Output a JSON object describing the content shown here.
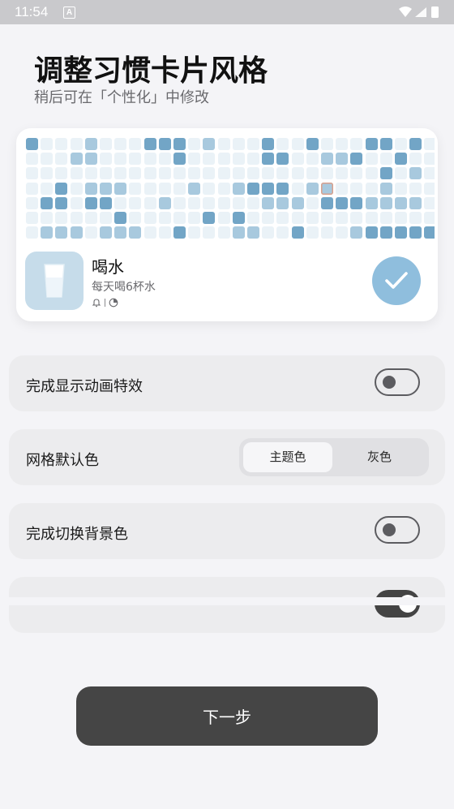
{
  "status_bar": {
    "time": "11:54",
    "notification_icon": "a-icon",
    "icons": [
      "wifi-icon",
      "signal-icon",
      "battery-icon"
    ]
  },
  "header": {
    "title": "调整习惯卡片风格",
    "subtitle": "稍后可在「个性化」中修改"
  },
  "preview": {
    "habit_name": "喝水",
    "habit_desc": "每天喝6杯水",
    "meta_icons": [
      "bell-icon",
      "chart-icon"
    ],
    "grid_colors": {
      "light": "#eaf2f7",
      "mid": "#a8c9de",
      "dark": "#72a5c6",
      "accent": "#d9a08c"
    },
    "grid_rows": [
      "2000100022201000200200022020",
      "0001100000200000220011200200",
      "0000000000000000000000002010",
      "0020111000010012220120001000",
      "0220220001000000111022211110",
      "0000002000002020000000000000",
      "0111011100200011002000122222"
    ],
    "accent_cell": {
      "row": 3,
      "col": 20
    },
    "complete_icon": "check-icon",
    "accent_color": "#8fbedd"
  },
  "settings": [
    {
      "label": "完成显示动画特效",
      "type": "toggle",
      "value": false
    },
    {
      "label": "网格默认色",
      "type": "segmented",
      "options": [
        "主题色",
        "灰色"
      ],
      "selected": "主题色"
    },
    {
      "label": "完成切换背景色",
      "type": "toggle",
      "value": false
    },
    {
      "label": "",
      "type": "toggle",
      "value": true
    }
  ],
  "footer": {
    "next_label": "下一步"
  }
}
